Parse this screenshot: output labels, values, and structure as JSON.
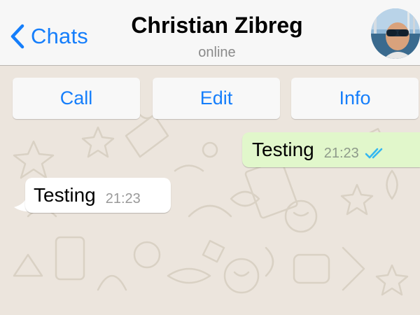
{
  "header": {
    "back_label": "Chats",
    "contact_name": "Christian Zibreg",
    "status": "online"
  },
  "actions": [
    {
      "label": "Call"
    },
    {
      "label": "Edit"
    },
    {
      "label": "Info"
    }
  ],
  "messages": [
    {
      "direction": "outgoing",
      "text": "Testing",
      "time": "21:23",
      "status_icon": "double-check-icon"
    },
    {
      "direction": "incoming",
      "text": "Testing",
      "time": "21:23"
    }
  ],
  "colors": {
    "accent": "#157efb",
    "outgoing_bubble": "#e1f7cb",
    "incoming_bubble": "#ffffff",
    "chat_background": "#ece5dd",
    "read_ticks": "#34b7f1"
  }
}
